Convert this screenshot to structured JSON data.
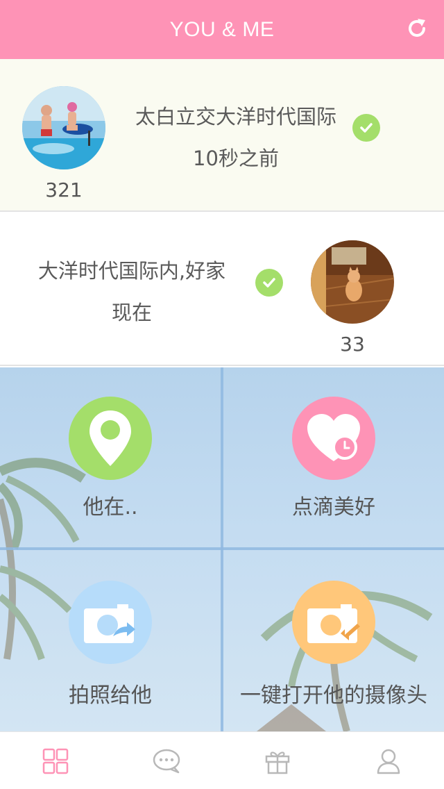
{
  "header": {
    "title": "YOU & ME",
    "refresh_icon": "refresh-icon",
    "color": "#fe93b6"
  },
  "status_cards": [
    {
      "location": "太白立交大洋时代国际",
      "time": "10秒之前",
      "count": "321",
      "status_icon": "check-circle-icon"
    },
    {
      "location": "大洋时代国际内,好家",
      "time": "现在",
      "count": "33",
      "status_icon": "check-circle-icon"
    }
  ],
  "features": [
    {
      "label": "他在..",
      "icon": "location-pin-icon",
      "color": "#a4de6a"
    },
    {
      "label": "点滴美好",
      "icon": "heart-clock-icon",
      "color": "#fe93b6"
    },
    {
      "label": "拍照给他",
      "icon": "camera-send-icon",
      "color": "#b6dcfa"
    },
    {
      "label": "一键打开他的摄像头",
      "icon": "camera-receive-icon",
      "color": "#ffc77a"
    }
  ],
  "tabbar": {
    "items": [
      {
        "icon": "grid-icon",
        "active": true
      },
      {
        "icon": "chat-icon",
        "active": false
      },
      {
        "icon": "gift-icon",
        "active": false
      },
      {
        "icon": "profile-icon",
        "active": false
      }
    ],
    "active_color": "#fe93b6",
    "inactive_color": "#b8b8b8"
  },
  "colors": {
    "check_green": "#a4de6a",
    "card1_bg": "#fafbf1"
  }
}
